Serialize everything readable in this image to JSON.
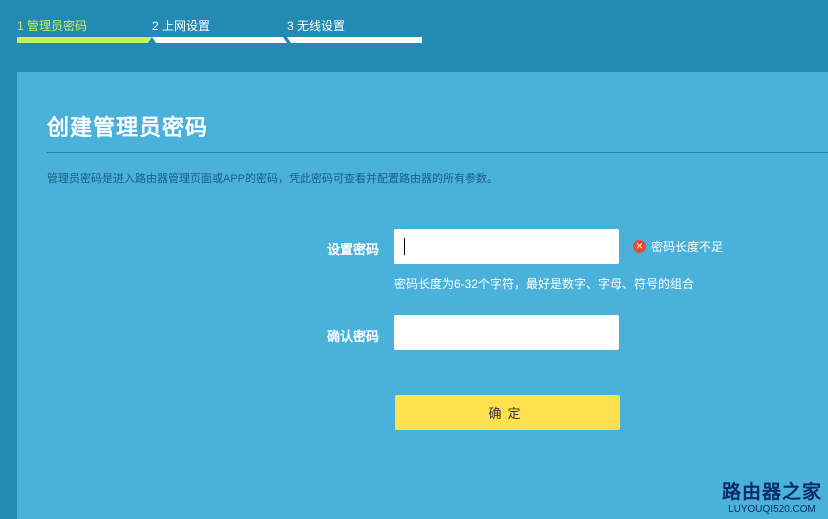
{
  "steps": [
    {
      "label": "1 管理员密码",
      "active": true
    },
    {
      "label": "2 上网设置",
      "active": false
    },
    {
      "label": "3 无线设置",
      "active": false
    }
  ],
  "page": {
    "title": "创建管理员密码",
    "description": "管理员密码是进入路由器管理页面或APP的密码，凭此密码可查看并配置路由器的所有参数。"
  },
  "form": {
    "password_label": "设置密码",
    "password_value": "",
    "error_text": "密码长度不足",
    "hint": "密码长度为6-32个字符，最好是数字、字母、符号的组合",
    "confirm_label": "确认密码",
    "confirm_value": "",
    "submit_label": "确定"
  },
  "watermark": {
    "top": "路由器之家",
    "bottom": "LUYOUQI520.COM"
  },
  "colors": {
    "background": "#238ab4",
    "panel": "#49b1da",
    "active_step": "#c9ef5c",
    "button": "#ffe14f",
    "error": "#e84a33"
  }
}
